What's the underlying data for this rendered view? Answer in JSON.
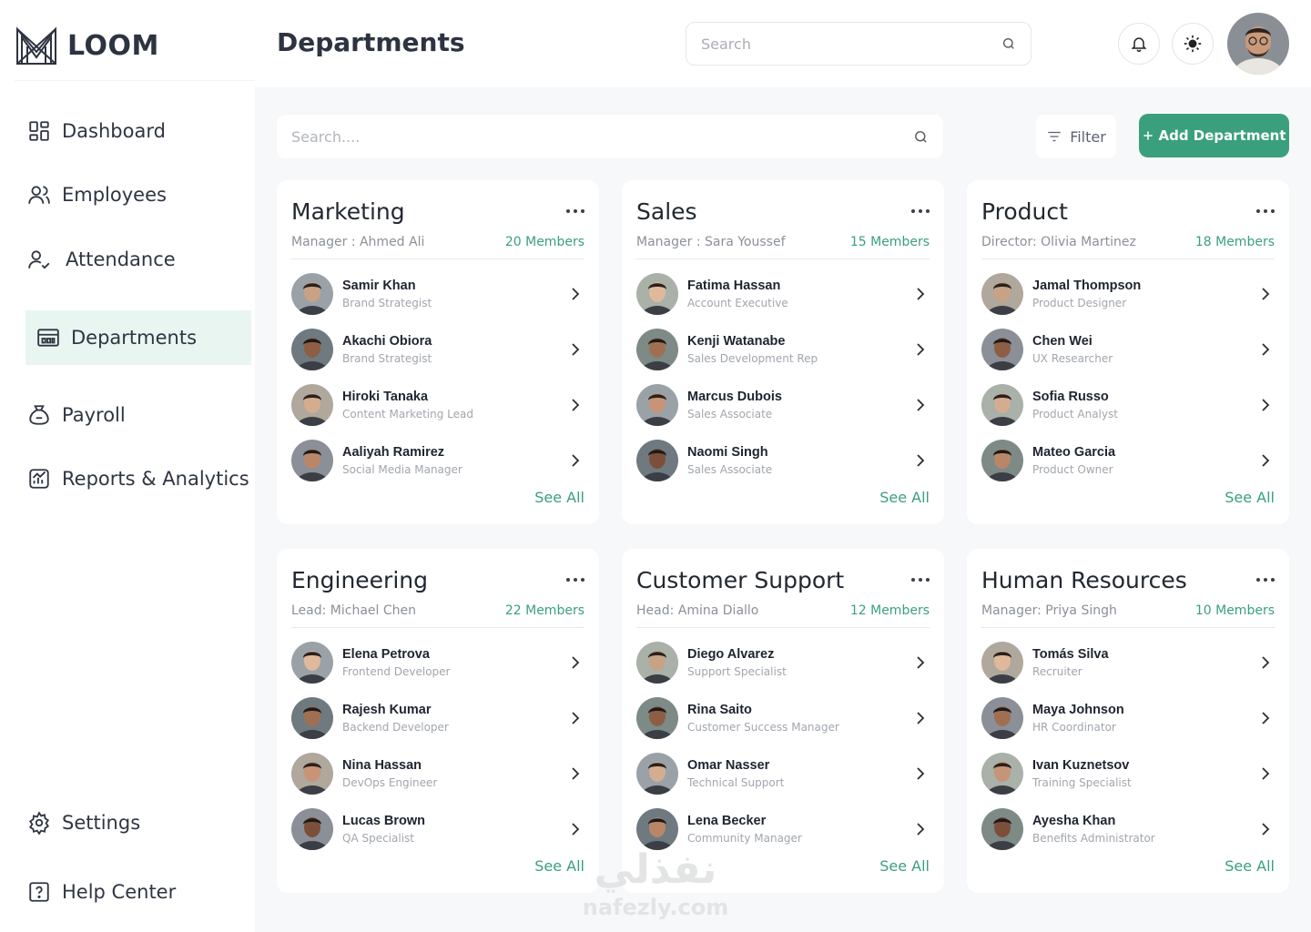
{
  "app": {
    "logo_text": "LOOM"
  },
  "sidebar": {
    "items": [
      {
        "label": "Dashboard",
        "icon": "dashboard-icon"
      },
      {
        "label": "Employees",
        "icon": "users-icon"
      },
      {
        "label": "Attendance",
        "icon": "user-check-icon"
      },
      {
        "label": "Departments",
        "icon": "building-icon",
        "active": true
      },
      {
        "label": "Payroll",
        "icon": "money-bag-icon"
      },
      {
        "label": "Reports & Analytics",
        "icon": "chart-icon"
      }
    ],
    "bottom": [
      {
        "label": "Settings",
        "icon": "gear-icon"
      },
      {
        "label": "Help Center",
        "icon": "help-icon"
      }
    ]
  },
  "header": {
    "title": "Departments",
    "search_placeholder": "Search"
  },
  "toolbar": {
    "search_placeholder": "Search....",
    "filter_label": "Filter",
    "add_label": "Add Department"
  },
  "colors": {
    "accent": "#3a9f7d",
    "active_bg": "#e9f5f1",
    "main_bg": "#f7f8f9"
  },
  "departments": [
    {
      "name": "Marketing",
      "lead": "Manager : Ahmed Ali",
      "members_count": "20 Members",
      "see_all": "See All",
      "members": [
        {
          "name": "Samir Khan",
          "role": "Brand Strategist"
        },
        {
          "name": "Akachi Obiora",
          "role": "Brand Strategist"
        },
        {
          "name": "Hiroki Tanaka",
          "role": "Content Marketing Lead"
        },
        {
          "name": "Aaliyah Ramirez",
          "role": "Social Media Manager"
        }
      ]
    },
    {
      "name": "Sales",
      "lead": "Manager : Sara Youssef",
      "members_count": "15 Members",
      "see_all": "See All",
      "members": [
        {
          "name": "Fatima Hassan",
          "role": "Account Executive"
        },
        {
          "name": "Kenji Watanabe",
          "role": "Sales Development Rep"
        },
        {
          "name": "Marcus Dubois",
          "role": "Sales Associate"
        },
        {
          "name": "Naomi Singh",
          "role": "Sales Associate"
        }
      ]
    },
    {
      "name": "Product",
      "lead": "Director: Olivia Martinez",
      "members_count": "18 Members",
      "see_all": "See All",
      "members": [
        {
          "name": "Jamal Thompson",
          "role": "Product Designer"
        },
        {
          "name": "Chen Wei",
          "role": "UX Researcher"
        },
        {
          "name": "Sofia Russo",
          "role": "Product Analyst"
        },
        {
          "name": "Mateo Garcia",
          "role": "Product Owner"
        }
      ]
    },
    {
      "name": "Engineering",
      "lead": "Lead: Michael Chen",
      "members_count": "22 Members",
      "see_all": "See All",
      "members": [
        {
          "name": "Elena Petrova",
          "role": "Frontend Developer"
        },
        {
          "name": "Rajesh Kumar",
          "role": "Backend Developer"
        },
        {
          "name": "Nina Hassan",
          "role": "DevOps Engineer"
        },
        {
          "name": "Lucas Brown",
          "role": "QA Specialist"
        }
      ]
    },
    {
      "name": "Customer Support",
      "lead": "Head: Amina Diallo",
      "members_count": "12 Members",
      "see_all": "See All",
      "members": [
        {
          "name": "Diego Alvarez",
          "role": "Support Specialist"
        },
        {
          "name": "Rina Saito",
          "role": "Customer Success Manager"
        },
        {
          "name": "Omar Nasser",
          "role": "Technical Support"
        },
        {
          "name": "Lena Becker",
          "role": "Community Manager"
        }
      ]
    },
    {
      "name": "Human Resources",
      "lead": "Manager: Priya Singh",
      "members_count": "10 Members",
      "see_all": "See All",
      "members": [
        {
          "name": "Tomás Silva",
          "role": "Recruiter"
        },
        {
          "name": "Maya Johnson",
          "role": "HR Coordinator"
        },
        {
          "name": "Ivan Kuznetsov",
          "role": "Training Specialist"
        },
        {
          "name": "Ayesha Khan",
          "role": "Benefits Administrator"
        }
      ]
    }
  ],
  "watermark": {
    "arabic": "نفذلي",
    "latin": "nafezly.com"
  }
}
